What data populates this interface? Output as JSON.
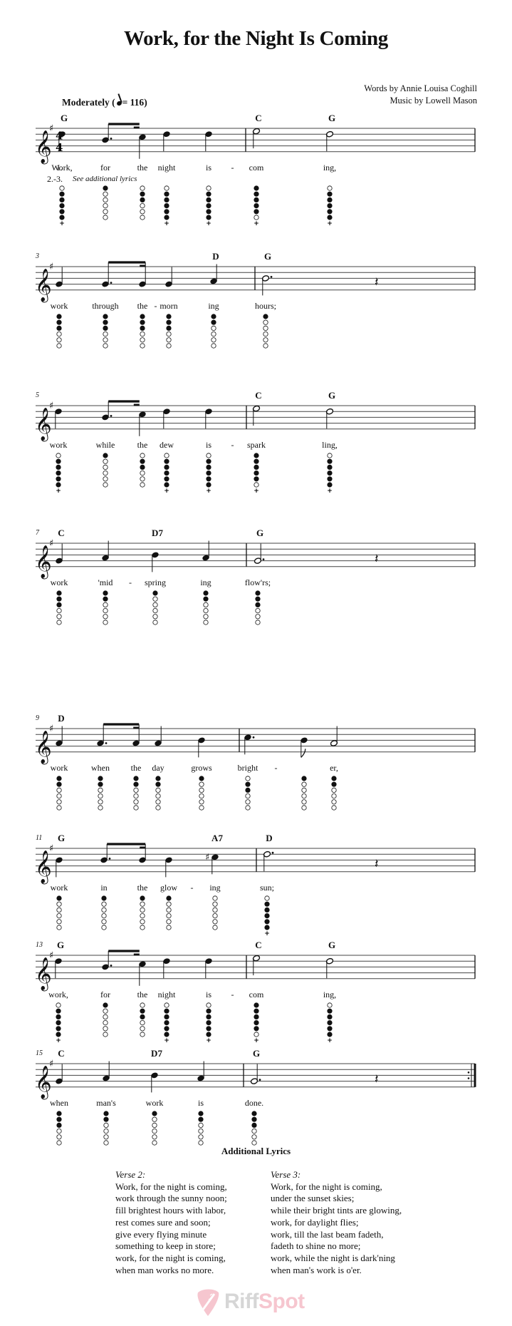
{
  "title": "Work, for the Night Is Coming",
  "credits": {
    "words": "Words by Annie Louisa Coghill",
    "music": "Music by Lowell Mason"
  },
  "tempo": {
    "marking": "Moderately",
    "bpm_text": "= 116",
    "open": "(",
    "close": ")"
  },
  "key_signature": "G major (1 sharp)",
  "time_signature": "4/4",
  "verse_labels": {
    "first": "1.",
    "others": "2.-3.",
    "others_text": "See additional lyrics"
  },
  "systems": [
    {
      "measure_number": "",
      "chords": [
        {
          "label": "G",
          "at": 0
        },
        {
          "label": "C",
          "at": 5
        },
        {
          "label": "G",
          "at": 6
        }
      ],
      "notes": [
        {
          "pitch": "D5",
          "dur": "q",
          "lyric": "Work,",
          "fingering": [
            0,
            1,
            1,
            1,
            1,
            1
          ],
          "plus": true
        },
        {
          "pitch": "B4",
          "dur": "8.",
          "beam": "start",
          "lyric": "for",
          "fingering": [
            1,
            0,
            0,
            0,
            0,
            0
          ],
          "plus": false
        },
        {
          "pitch": "C5",
          "dur": "16",
          "beam": "end",
          "lyric": "the",
          "fingering": [
            0,
            1,
            1,
            0,
            0,
            0
          ],
          "plus": false
        },
        {
          "pitch": "D5",
          "dur": "q",
          "lyric": "night",
          "fingering": [
            0,
            1,
            1,
            1,
            1,
            1
          ],
          "plus": true
        },
        {
          "pitch": "D5",
          "dur": "q",
          "lyric": "is",
          "fingering": [
            0,
            1,
            1,
            1,
            1,
            1
          ],
          "plus": true
        },
        {
          "pitch": "E5",
          "dur": "h",
          "lyric": "com",
          "fingering": [
            1,
            1,
            1,
            1,
            1,
            0
          ],
          "plus": true,
          "bar_before": true
        },
        {
          "pitch": "D5",
          "dur": "h",
          "lyric": "ing,",
          "fingering": [
            0,
            1,
            1,
            1,
            1,
            1
          ],
          "plus": true
        }
      ],
      "hyphens": [
        5
      ],
      "end": "bar"
    },
    {
      "measure_number": "3",
      "chords": [
        {
          "label": "D",
          "at": 4
        },
        {
          "label": "G",
          "at": 5
        }
      ],
      "notes": [
        {
          "pitch": "G4",
          "dur": "q",
          "lyric": "work",
          "fingering": [
            1,
            1,
            1,
            0,
            0,
            0
          ],
          "plus": false
        },
        {
          "pitch": "G4",
          "dur": "8.",
          "beam": "start",
          "lyric": "through",
          "fingering": [
            1,
            1,
            1,
            0,
            0,
            0
          ],
          "plus": false
        },
        {
          "pitch": "G4",
          "dur": "16",
          "beam": "end",
          "lyric": "the",
          "fingering": [
            1,
            1,
            1,
            0,
            0,
            0
          ],
          "plus": false
        },
        {
          "pitch": "G4",
          "dur": "q",
          "lyric": "morn",
          "fingering": [
            1,
            1,
            1,
            0,
            0,
            0
          ],
          "plus": false
        },
        {
          "pitch": "A4",
          "dur": "q",
          "lyric": "ing",
          "fingering": [
            1,
            1,
            0,
            0,
            0,
            0
          ],
          "plus": false
        },
        {
          "pitch": "B4",
          "dur": "h.",
          "lyric": "hours;",
          "fingering": [
            1,
            0,
            0,
            0,
            0,
            0
          ],
          "plus": false,
          "bar_before": true
        },
        {
          "rest": "q"
        }
      ],
      "hyphens": [
        3
      ],
      "end": "bar"
    },
    {
      "measure_number": "5",
      "chords": [
        {
          "label": "C",
          "at": 5
        },
        {
          "label": "G",
          "at": 6
        }
      ],
      "notes": [
        {
          "pitch": "D5",
          "dur": "q",
          "lyric": "work",
          "fingering": [
            0,
            1,
            1,
            1,
            1,
            1
          ],
          "plus": true
        },
        {
          "pitch": "B4",
          "dur": "8.",
          "beam": "start",
          "lyric": "while",
          "fingering": [
            1,
            0,
            0,
            0,
            0,
            0
          ],
          "plus": false
        },
        {
          "pitch": "C5",
          "dur": "16",
          "beam": "end",
          "lyric": "the",
          "fingering": [
            0,
            1,
            1,
            0,
            0,
            0
          ],
          "plus": false
        },
        {
          "pitch": "D5",
          "dur": "q",
          "lyric": "dew",
          "fingering": [
            0,
            1,
            1,
            1,
            1,
            1
          ],
          "plus": true
        },
        {
          "pitch": "D5",
          "dur": "q",
          "lyric": "is",
          "fingering": [
            0,
            1,
            1,
            1,
            1,
            1
          ],
          "plus": true
        },
        {
          "pitch": "E5",
          "dur": "h",
          "lyric": "spark",
          "fingering": [
            1,
            1,
            1,
            1,
            1,
            0
          ],
          "plus": true,
          "bar_before": true
        },
        {
          "pitch": "D5",
          "dur": "h",
          "lyric": "ling,",
          "fingering": [
            0,
            1,
            1,
            1,
            1,
            1
          ],
          "plus": true
        }
      ],
      "hyphens": [
        5
      ],
      "end": "bar"
    },
    {
      "measure_number": "7",
      "chords": [
        {
          "label": "C",
          "at": 0
        },
        {
          "label": "D7",
          "at": 2
        },
        {
          "label": "G",
          "at": 4
        }
      ],
      "notes": [
        {
          "pitch": "G4",
          "dur": "q",
          "lyric": "work",
          "fingering": [
            1,
            1,
            1,
            0,
            0,
            0
          ],
          "plus": false
        },
        {
          "pitch": "A4",
          "dur": "q",
          "lyric": "'mid",
          "fingering": [
            1,
            1,
            0,
            0,
            0,
            0
          ],
          "plus": false
        },
        {
          "pitch": "B4",
          "dur": "q",
          "lyric": "spring",
          "fingering": [
            1,
            0,
            0,
            0,
            0,
            0
          ],
          "plus": false
        },
        {
          "pitch": "A4",
          "dur": "q",
          "lyric": "ing",
          "fingering": [
            1,
            1,
            0,
            0,
            0,
            0
          ],
          "plus": false
        },
        {
          "pitch": "G4",
          "dur": "h.",
          "lyric": "flow'rs;",
          "fingering": [
            1,
            1,
            1,
            0,
            0,
            0
          ],
          "plus": false,
          "bar_before": true
        },
        {
          "rest": "q"
        }
      ],
      "hyphens": [
        2
      ],
      "end": "bar"
    },
    {
      "measure_number": "9",
      "chords": [
        {
          "label": "D",
          "at": 0
        }
      ],
      "notes": [
        {
          "pitch": "A4",
          "dur": "q",
          "lyric": "work",
          "fingering": [
            1,
            1,
            0,
            0,
            0,
            0
          ],
          "plus": false
        },
        {
          "pitch": "A4",
          "dur": "8.",
          "beam": "start",
          "lyric": "when",
          "fingering": [
            1,
            1,
            0,
            0,
            0,
            0
          ],
          "plus": false
        },
        {
          "pitch": "A4",
          "dur": "16",
          "beam": "end",
          "lyric": "the",
          "fingering": [
            1,
            1,
            0,
            0,
            0,
            0
          ],
          "plus": false
        },
        {
          "pitch": "A4",
          "dur": "q",
          "lyric": "day",
          "fingering": [
            1,
            1,
            0,
            0,
            0,
            0
          ],
          "plus": false
        },
        {
          "pitch": "B4",
          "dur": "q",
          "lyric": "grows",
          "fingering": [
            1,
            0,
            0,
            0,
            0,
            0
          ],
          "plus": false
        },
        {
          "pitch": "C5",
          "dur": "q.",
          "lyric": "bright",
          "fingering": [
            0,
            1,
            1,
            0,
            0,
            0
          ],
          "plus": false,
          "bar_before": true
        },
        {
          "pitch": "B4",
          "dur": "8",
          "lyric": "",
          "fingering": [
            1,
            0,
            0,
            0,
            0,
            0
          ],
          "plus": false
        },
        {
          "pitch": "A4",
          "dur": "h",
          "lyric": "er,",
          "fingering": [
            1,
            1,
            0,
            0,
            0,
            0
          ],
          "plus": false
        }
      ],
      "hyphens": [
        6
      ],
      "end": "bar"
    },
    {
      "measure_number": "11",
      "chords": [
        {
          "label": "G",
          "at": 0
        },
        {
          "label": "A7",
          "at": 4
        },
        {
          "label": "D",
          "at": 5
        }
      ],
      "notes": [
        {
          "pitch": "B4",
          "dur": "q",
          "lyric": "work",
          "fingering": [
            1,
            0,
            0,
            0,
            0,
            0
          ],
          "plus": false
        },
        {
          "pitch": "B4",
          "dur": "8.",
          "beam": "start",
          "lyric": "in",
          "fingering": [
            1,
            0,
            0,
            0,
            0,
            0
          ],
          "plus": false
        },
        {
          "pitch": "B4",
          "dur": "16",
          "beam": "end",
          "lyric": "the",
          "fingering": [
            1,
            0,
            0,
            0,
            0,
            0
          ],
          "plus": false
        },
        {
          "pitch": "B4",
          "dur": "q",
          "lyric": "glow",
          "fingering": [
            1,
            0,
            0,
            0,
            0,
            0
          ],
          "plus": false
        },
        {
          "pitch": "C#5",
          "dur": "q",
          "accidental": "♯",
          "lyric": "ing",
          "fingering": [
            0,
            0,
            0,
            0,
            0,
            0
          ],
          "plus": false
        },
        {
          "pitch": "D5",
          "dur": "h.",
          "lyric": "sun;",
          "fingering": [
            0,
            1,
            1,
            1,
            1,
            1
          ],
          "plus": true,
          "bar_before": true
        },
        {
          "rest": "q"
        }
      ],
      "hyphens": [
        4
      ],
      "end": "bar"
    },
    {
      "measure_number": "13",
      "chords": [
        {
          "label": "G",
          "at": 0
        },
        {
          "label": "C",
          "at": 5
        },
        {
          "label": "G",
          "at": 6
        }
      ],
      "notes": [
        {
          "pitch": "D5",
          "dur": "q",
          "lyric": "work,",
          "fingering": [
            0,
            1,
            1,
            1,
            1,
            1
          ],
          "plus": true
        },
        {
          "pitch": "B4",
          "dur": "8.",
          "beam": "start",
          "lyric": "for",
          "fingering": [
            1,
            0,
            0,
            0,
            0,
            0
          ],
          "plus": false
        },
        {
          "pitch": "C5",
          "dur": "16",
          "beam": "end",
          "lyric": "the",
          "fingering": [
            0,
            1,
            1,
            0,
            0,
            0
          ],
          "plus": false
        },
        {
          "pitch": "D5",
          "dur": "q",
          "lyric": "night",
          "fingering": [
            0,
            1,
            1,
            1,
            1,
            1
          ],
          "plus": true
        },
        {
          "pitch": "D5",
          "dur": "q",
          "lyric": "is",
          "fingering": [
            0,
            1,
            1,
            1,
            1,
            1
          ],
          "plus": true
        },
        {
          "pitch": "E5",
          "dur": "h",
          "lyric": "com",
          "fingering": [
            1,
            1,
            1,
            1,
            1,
            0
          ],
          "plus": true,
          "bar_before": true
        },
        {
          "pitch": "D5",
          "dur": "h",
          "lyric": "ing,",
          "fingering": [
            0,
            1,
            1,
            1,
            1,
            1
          ],
          "plus": true
        }
      ],
      "hyphens": [
        5
      ],
      "end": "bar"
    },
    {
      "measure_number": "15",
      "chords": [
        {
          "label": "C",
          "at": 0
        },
        {
          "label": "D7",
          "at": 2
        },
        {
          "label": "G",
          "at": 4
        }
      ],
      "notes": [
        {
          "pitch": "G4",
          "dur": "q",
          "lyric": "when",
          "fingering": [
            1,
            1,
            1,
            0,
            0,
            0
          ],
          "plus": false
        },
        {
          "pitch": "A4",
          "dur": "q",
          "lyric": "man's",
          "fingering": [
            1,
            1,
            0,
            0,
            0,
            0
          ],
          "plus": false
        },
        {
          "pitch": "B4",
          "dur": "q",
          "lyric": "work",
          "fingering": [
            1,
            0,
            0,
            0,
            0,
            0
          ],
          "plus": false
        },
        {
          "pitch": "A4",
          "dur": "q",
          "lyric": "is",
          "fingering": [
            1,
            1,
            0,
            0,
            0,
            0
          ],
          "plus": false
        },
        {
          "pitch": "G4",
          "dur": "h.",
          "lyric": "done.",
          "fingering": [
            1,
            1,
            1,
            0,
            0,
            0
          ],
          "plus": false,
          "bar_before": true
        },
        {
          "rest": "q"
        }
      ],
      "hyphens": [],
      "end": "repeat"
    }
  ],
  "additional_lyrics": {
    "heading": "Additional Lyrics",
    "verses": [
      {
        "label": "Verse 2:",
        "lines": [
          "Work, for the night is coming,",
          "work through the sunny noon;",
          "fill brightest hours with labor,",
          "rest comes sure and soon;",
          "give every flying minute",
          "something to keep in store;",
          "work, for the night is coming,",
          "when man works no more."
        ]
      },
      {
        "label": "Verse 3:",
        "lines": [
          "Work, for the night is coming,",
          "under the sunset skies;",
          "while their bright tints are glowing,",
          "work, for daylight flies;",
          "work, till the last beam fadeth,",
          "fadeth to shine no more;",
          "work, while the night is dark'ning",
          "when man's work is o'er."
        ]
      }
    ]
  },
  "logo": {
    "part1": "Riff",
    "part2": "Spot",
    "colors": {
      "riff": "#d6d6d6",
      "spot": "#f6c6cf"
    }
  }
}
